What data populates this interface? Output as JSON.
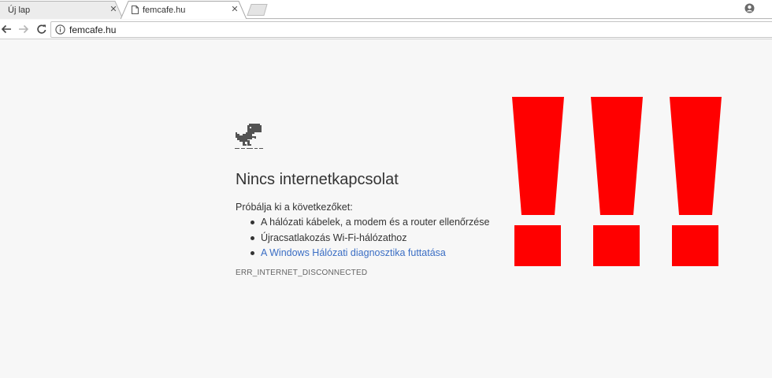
{
  "tabs": [
    {
      "title": "Új lap",
      "active": false
    },
    {
      "title": "femcafe.hu",
      "active": true
    }
  ],
  "toolbar": {
    "url": "femcafe.hu"
  },
  "error": {
    "title": "Nincs internetkapcsolat",
    "suggestions_intro": "Próbálja ki a következőket:",
    "suggestions": [
      "A hálózati kábelek, a modem és a router ellenőrzése",
      "Újracsatlakozás Wi-Fi-hálózathoz"
    ],
    "diagnostics_link": "A Windows Hálózati diagnosztika futtatása",
    "code": "ERR_INTERNET_DISCONNECTED"
  },
  "colors": {
    "page_background": "#f7f7f7",
    "link": "#3b6ec4",
    "exclamation_red": "#ff0000"
  },
  "icons": [
    "close-icon",
    "document-icon",
    "new-tab-icon",
    "profile-icon",
    "back-arrow-icon",
    "forward-arrow-icon",
    "reload-icon",
    "info-icon",
    "dino-icon",
    "exclamation-mark-icon"
  ]
}
